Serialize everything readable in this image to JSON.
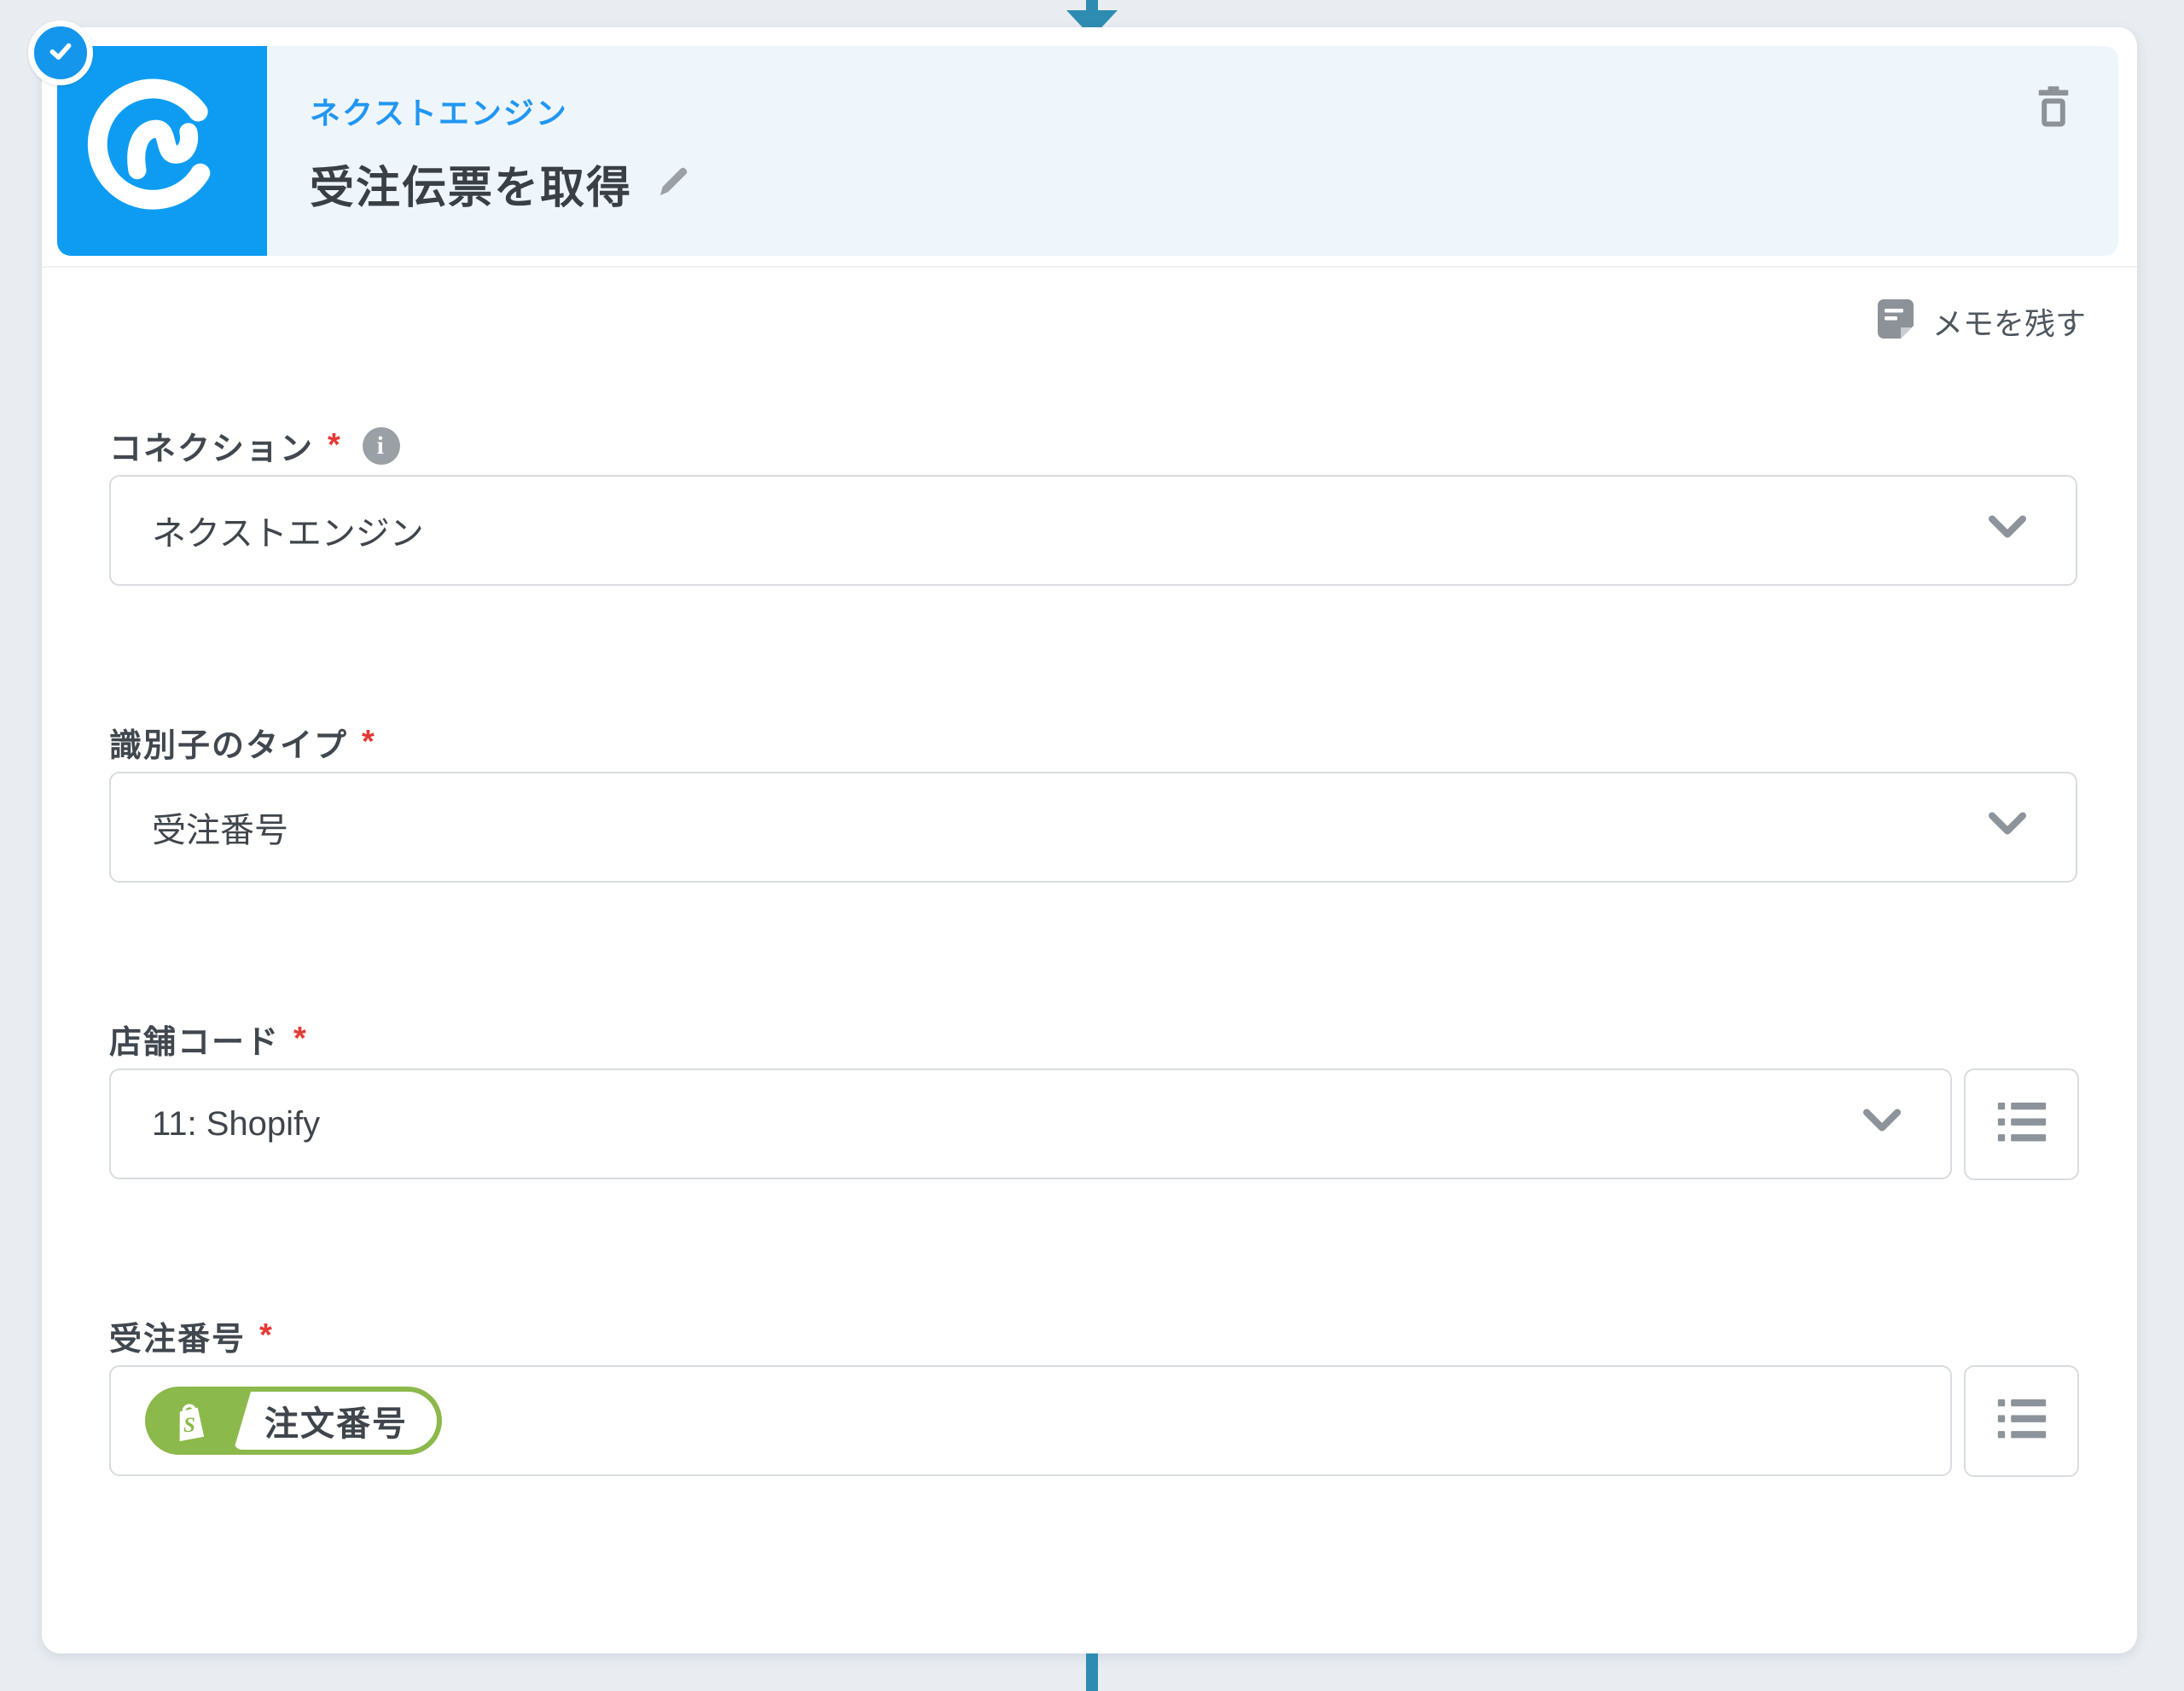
{
  "ui": {
    "required_mark": "*"
  },
  "step": {
    "app_name": "ネクストエンジン",
    "title": "受注伝票を取得",
    "memo_link": "メモを残す",
    "status_icon": "check-badge-icon",
    "delete_icon": "trash-icon",
    "edit_icon": "pencil-icon",
    "app_icon": "nextengine-logo-icon"
  },
  "fields": {
    "connection": {
      "label": "コネクション",
      "value": "ネクストエンジン",
      "type": "select",
      "info_icon": "info-icon"
    },
    "identifier_type": {
      "label": "識別子のタイプ",
      "value": "受注番号",
      "type": "select"
    },
    "store_code": {
      "label": "店舗コード",
      "value": "11: Shopify",
      "type": "select",
      "side_button_icon": "list-icon"
    },
    "order_number": {
      "label": "受注番号",
      "token_label": "注文番号",
      "token_icon": "shopify-bag-icon",
      "side_button_icon": "list-icon"
    }
  },
  "colors": {
    "page_background": "#e9edf2",
    "header_background": "#eef6fc",
    "app_icon_blue": "#0d9cf2",
    "app_name_blue": "#2196f3",
    "badge_blue": "#1496ec",
    "connector_teal": "#2e8cb2",
    "required_red": "#e53935",
    "token_green": "#8cb94b"
  }
}
